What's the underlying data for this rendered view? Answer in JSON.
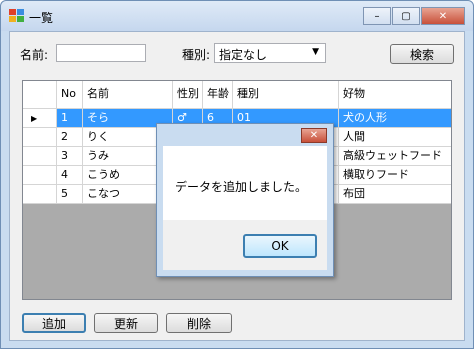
{
  "window": {
    "title": "一覧",
    "controls": {
      "minimize": "–",
      "maximize": "▢",
      "close": "✕"
    }
  },
  "search": {
    "name_label": "名前:",
    "name_value": "",
    "type_label": "種別:",
    "type_selected": "指定なし",
    "search_button": "検索"
  },
  "grid": {
    "columns": [
      "No",
      "名前",
      "性別",
      "年齢",
      "種別",
      "好物"
    ],
    "rows": [
      [
        "1",
        "そら",
        "♂",
        "6",
        "01",
        "犬の人形"
      ],
      [
        "2",
        "りく",
        "",
        "",
        "",
        "人間"
      ],
      [
        "3",
        "うみ",
        "",
        "",
        "",
        "高級ウェットフード"
      ],
      [
        "4",
        "こうめ",
        "",
        "",
        "",
        "横取りフード"
      ],
      [
        "5",
        "こなつ",
        "",
        "",
        "",
        "布団"
      ]
    ],
    "selected_row": 0,
    "row_indicator": "▶"
  },
  "actions": {
    "add_button": "追加",
    "update_button": "更新",
    "delete_button": "削除"
  },
  "dialog": {
    "message": "データを追加しました。",
    "ok_button": "OK",
    "close": "✕"
  },
  "colors": {
    "selection": "#3399ff",
    "title_gradient_top": "#dfeaf7",
    "close_button": "#c8503a"
  }
}
